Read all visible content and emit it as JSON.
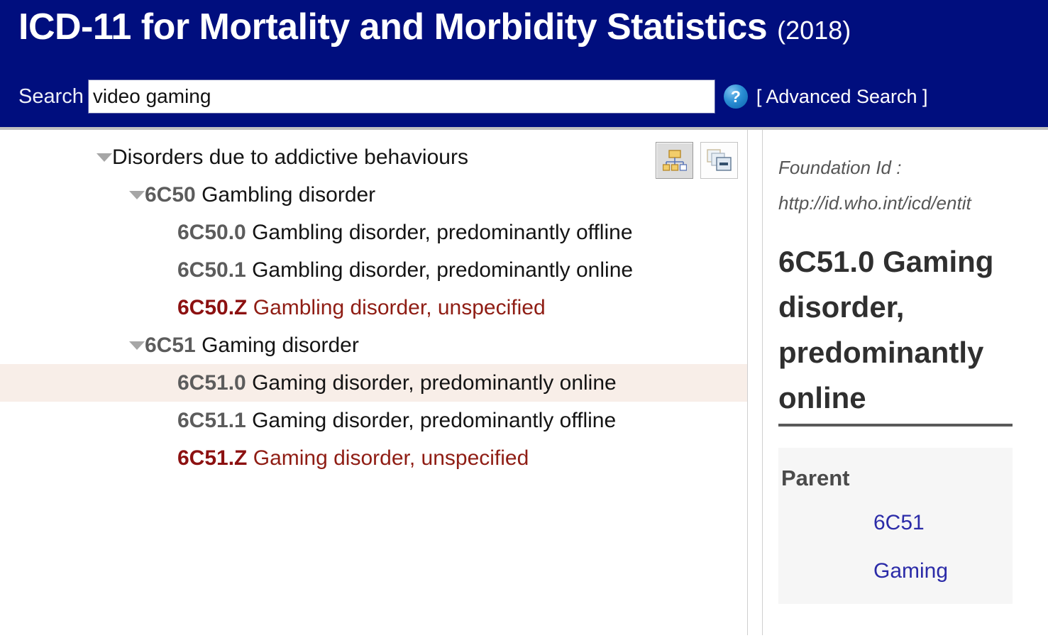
{
  "header": {
    "title_main": "ICD-11 for Mortality and Morbidity Statistics",
    "title_year": "(2018)",
    "search_label": "Search",
    "search_value": "video gaming",
    "search_placeholder": "",
    "help_icon": "?",
    "advanced_search": "[ Advanced Search ]",
    "background_color": "#000e7e"
  },
  "tree": {
    "toolbar": {
      "hierarchy_button_title": "hierarchy-view",
      "collapse_button_title": "collapse-all"
    },
    "rows": [
      {
        "level": 0,
        "twisty": "expanded",
        "code": "",
        "title": "Disorders due to addictive behaviours",
        "selected": false,
        "unspecified": false
      },
      {
        "level": 1,
        "twisty": "expanded",
        "code": "6C50",
        "title": "Gambling disorder",
        "selected": false,
        "unspecified": false
      },
      {
        "level": 2,
        "twisty": "none",
        "code": "6C50.0",
        "title": "Gambling disorder, predominantly offline",
        "selected": false,
        "unspecified": false
      },
      {
        "level": 2,
        "twisty": "none",
        "code": "6C50.1",
        "title": "Gambling disorder, predominantly online",
        "selected": false,
        "unspecified": false
      },
      {
        "level": 2,
        "twisty": "none",
        "code": "6C50.Z",
        "title": "Gambling disorder, unspecified",
        "selected": false,
        "unspecified": true
      },
      {
        "level": 1,
        "twisty": "expanded",
        "code": "6C51",
        "title": "Gaming disorder",
        "selected": false,
        "unspecified": false
      },
      {
        "level": 2,
        "twisty": "none",
        "code": "6C51.0",
        "title": "Gaming disorder, predominantly online",
        "selected": true,
        "unspecified": false
      },
      {
        "level": 2,
        "twisty": "none",
        "code": "6C51.1",
        "title": "Gaming disorder, predominantly offline",
        "selected": false,
        "unspecified": false
      },
      {
        "level": 2,
        "twisty": "none",
        "code": "6C51.Z",
        "title": "Gaming disorder, unspecified",
        "selected": false,
        "unspecified": true
      }
    ],
    "selected_row_color": "#f8eee8",
    "unspecified_color": "#8f1d14"
  },
  "detail": {
    "foundation_label": "Foundation Id :",
    "foundation_url": "http://id.who.int/icd/entit",
    "entity_code": "6C51.0",
    "entity_title": "Gaming disorder, predominantly online",
    "entity_heading_full": "6C51.0 Gaming disorder, predominantly online",
    "parent_heading": "Parent",
    "parent_code": "6C51",
    "parent_title": "Gaming",
    "parent_link_color": "#2b2ba8"
  }
}
